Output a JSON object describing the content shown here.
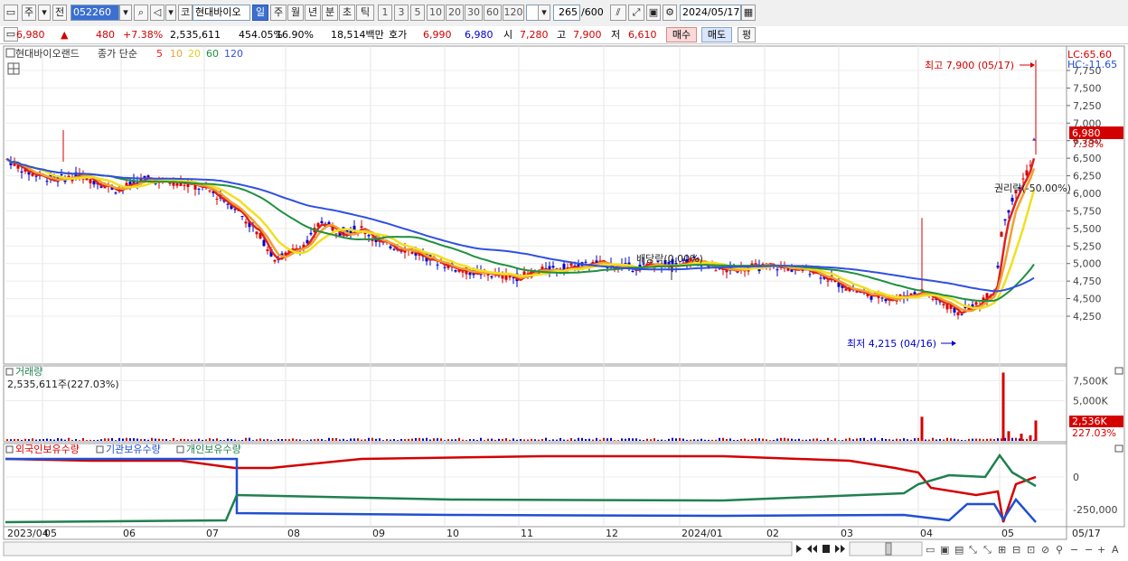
{
  "toolbar": {
    "period_label": "주",
    "prev_label": "전",
    "stock_code": "052260",
    "code_label": "코",
    "stock_name": "현대바이오",
    "period_buttons": [
      "일",
      "주",
      "월",
      "년",
      "분",
      "초",
      "틱"
    ],
    "selected_period": "일",
    "interval_buttons": [
      "1",
      "3",
      "5",
      "10",
      "20",
      "30",
      "60",
      "120"
    ],
    "count_value": "265",
    "count_max": "/600",
    "date_value": "2024/05/17"
  },
  "info": {
    "price": "6,980",
    "change_arrow": "▲",
    "change": "480",
    "change_pct": "+7.38%",
    "volume": "2,535,611",
    "volume_ratio": "454.05%",
    "turnover": "16.90%",
    "amount": "18,514백만",
    "quote_label": "호가",
    "ask": "6,990",
    "bid": "6,980",
    "open_label": "시",
    "open": "7,280",
    "high_label": "고",
    "high": "7,900",
    "low_label": "저",
    "low": "6,610",
    "buy_label": "매수",
    "sell_label": "매도",
    "eval_label": "평"
  },
  "price_panel": {
    "legend_name": "현대바이오랜드",
    "legend_ma_label": "종가 단순",
    "ma_periods": [
      {
        "label": "5",
        "color": "#e02020"
      },
      {
        "label": "10",
        "color": "#f0a030"
      },
      {
        "label": "20",
        "color": "#f0e020"
      },
      {
        "label": "60",
        "color": "#209040"
      },
      {
        "label": "120",
        "color": "#3050e0"
      }
    ],
    "lc_label": "LC:65.60",
    "hc_label": "HC:-11.65",
    "y_ticks": [
      "7,750",
      "7,500",
      "7,250",
      "7,000",
      "6,750",
      "6,500",
      "6,250",
      "6,000",
      "5,750",
      "5,500",
      "5,250",
      "5,000",
      "4,750",
      "4,500",
      "4,250"
    ],
    "current_price_tag": "6,980",
    "current_pct_tag": "7.38%",
    "high_annotation": "최고 7,900 (05/17)",
    "low_annotation": "최저 4,215 (04/16)",
    "dividend_annotation": "배당락(0.00%)",
    "rights_annotation": "권리락(-50.00%)"
  },
  "volume_panel": {
    "title": "거래량",
    "value_label": "2,535,611주(227.03%)",
    "y_ticks": [
      "7,500K",
      "5,000K"
    ],
    "current_tag": "2,536K",
    "current_pct": "227.03%"
  },
  "holding_panel": {
    "legend": [
      {
        "label": "외국인보유수량",
        "color": "#d40000"
      },
      {
        "label": "기관보유수량",
        "color": "#2050d0"
      },
      {
        "label": "개인보유수량",
        "color": "#208050"
      }
    ],
    "y_ticks": [
      "0",
      "-250,000"
    ]
  },
  "x_axis": {
    "labels": [
      "2023/04",
      "05",
      "06",
      "07",
      "08",
      "09",
      "10",
      "11",
      "12",
      "2024/01",
      "02",
      "03",
      "04",
      "05"
    ],
    "end_label": "05/17"
  },
  "colors": {
    "up": "#d40000",
    "down": "#0000cc",
    "ma5": "#e02020",
    "ma10": "#f0a030",
    "ma20": "#f0e020",
    "ma60": "#209040",
    "ma120": "#3050e0"
  }
}
